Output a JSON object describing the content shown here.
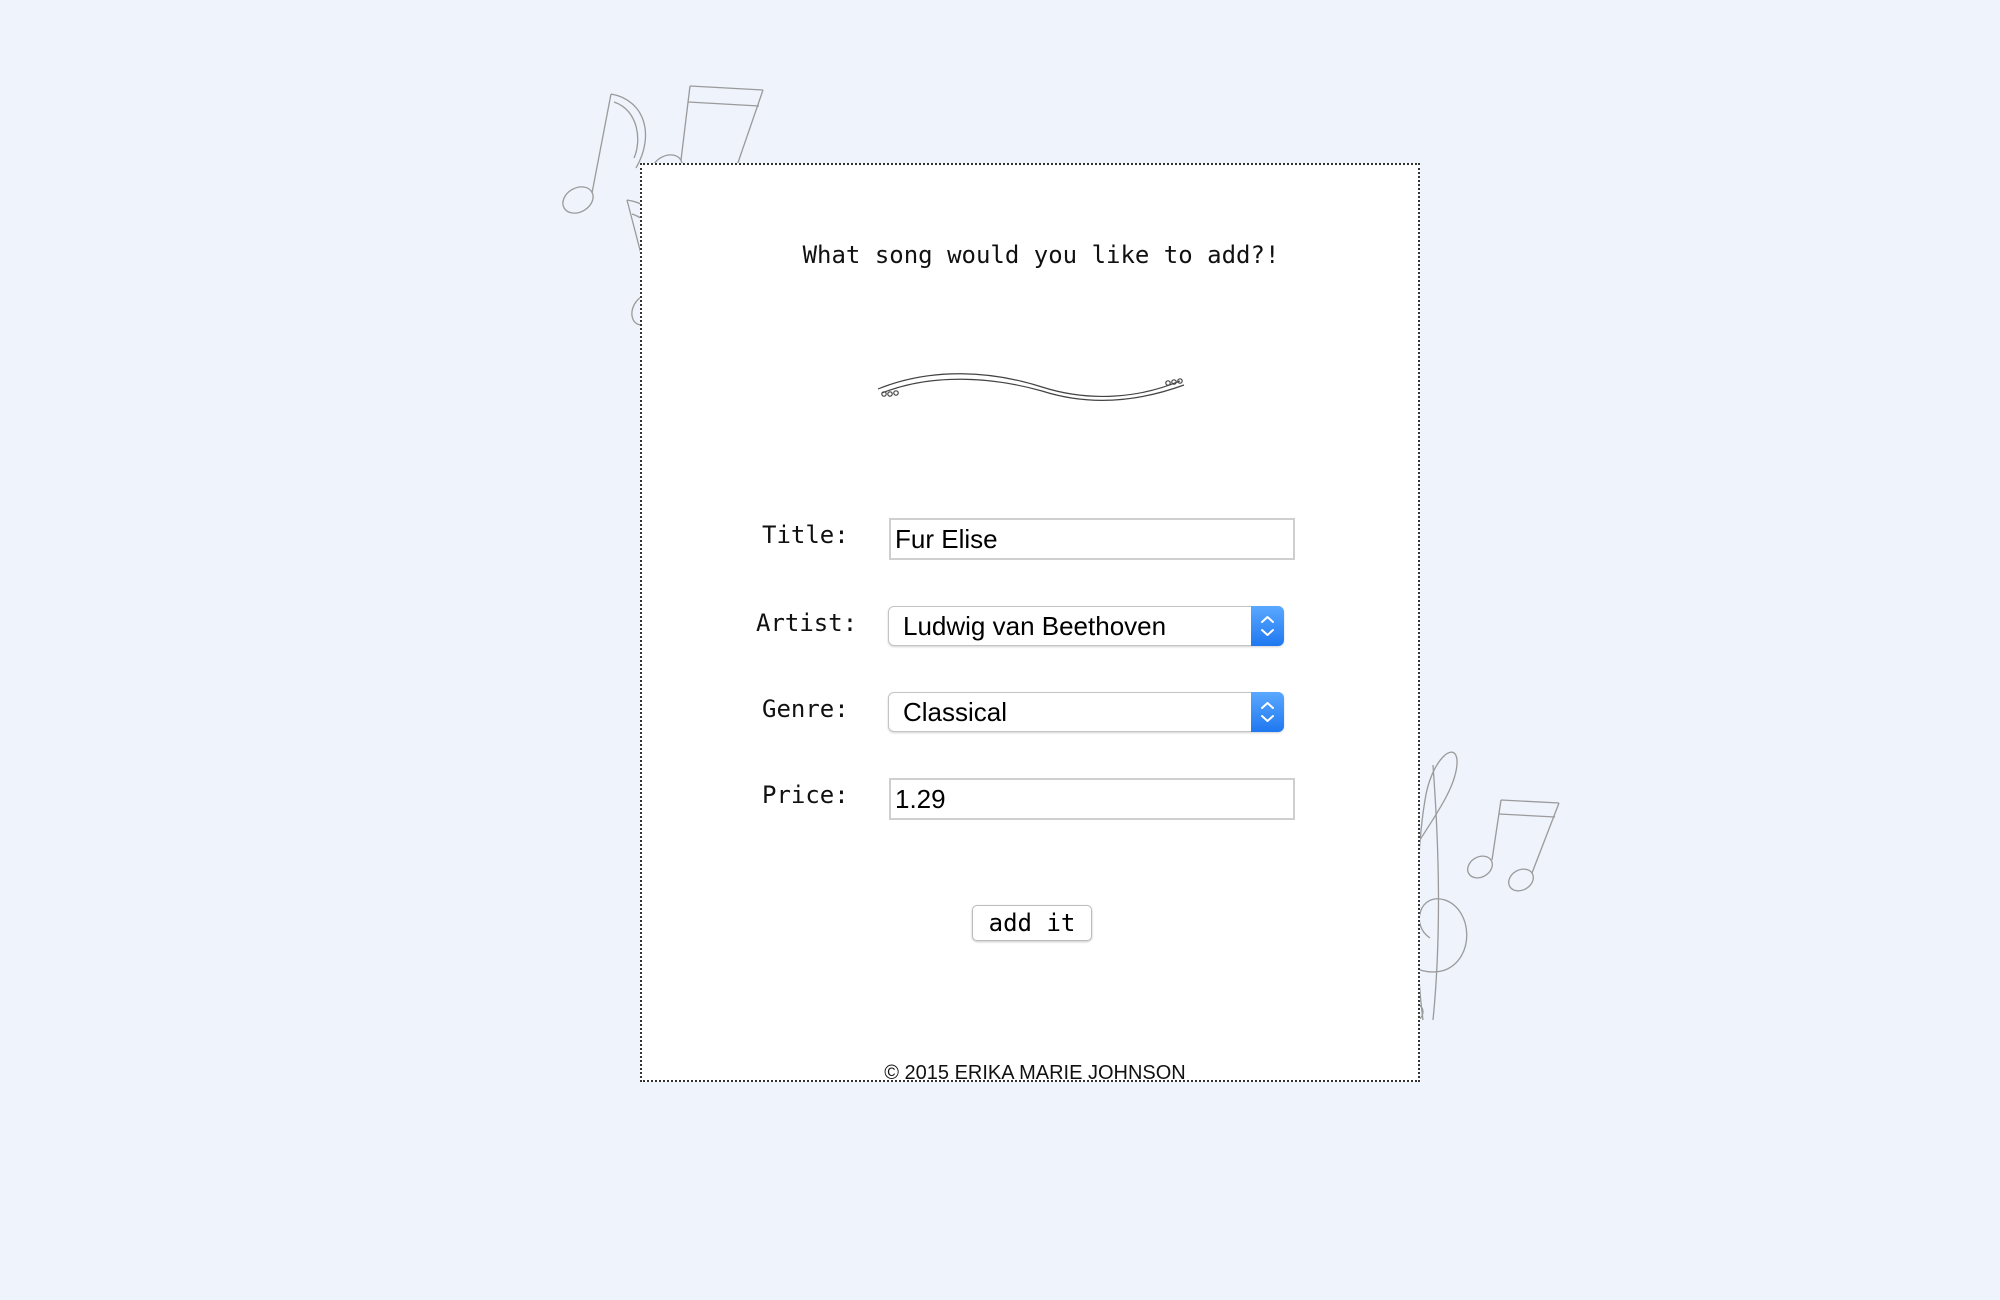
{
  "form": {
    "heading": "What song would you like to add?!",
    "fields": {
      "title": {
        "label": "Title:",
        "value": "Fur Elise"
      },
      "artist": {
        "label": "Artist:",
        "selected": "Ludwig van Beethoven"
      },
      "genre": {
        "label": "Genre:",
        "selected": "Classical"
      },
      "price": {
        "label": "Price:",
        "value": "1.29"
      }
    },
    "submit_label": "add it"
  },
  "footer": {
    "copyright": "© 2015 ERIKA MARIE JOHNSON"
  },
  "decorations": {
    "top_left": "music-notes-icon",
    "bottom_right": "treble-clef-and-notes-icon",
    "divider": "flourish-divider-icon"
  },
  "colors": {
    "page_background": "#eef3fc",
    "card_background": "#ffffff",
    "select_accent": "#2a80f5"
  }
}
